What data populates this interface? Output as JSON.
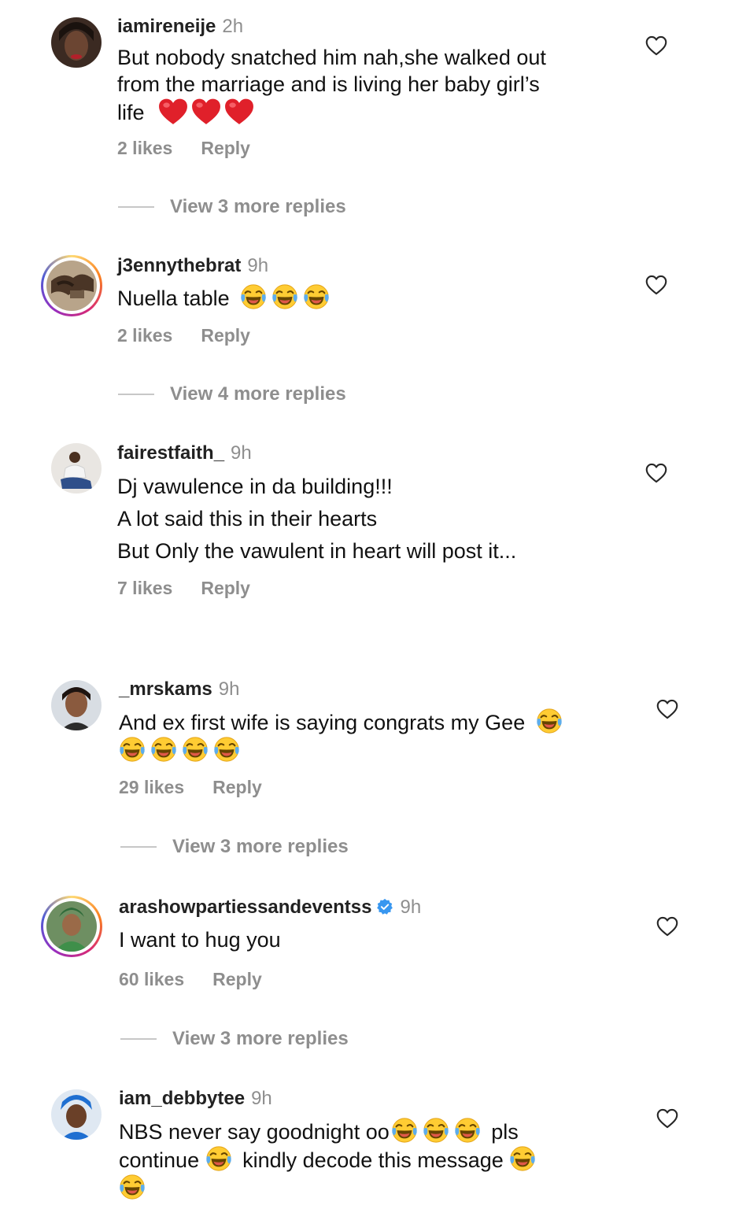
{
  "icons": {
    "like": "heart-outline-icon",
    "verified": "verified-badge-icon",
    "laugh_emoji": "face-with-tears-of-joy-emoji",
    "red_heart_emoji": "red-heart-emoji"
  },
  "colors": {
    "muted": "#8e8e8e",
    "text": "#111111",
    "verified_blue": "#3897f0",
    "story_ring": "#d62976"
  },
  "comments": [
    {
      "username": "iamireneije",
      "time": "2h",
      "text_lines": [
        "But nobody snatched him nah,she walked out",
        "from the marriage and is living her baby girl’s",
        "life"
      ],
      "likes": "2 likes",
      "reply": "Reply",
      "view_more": "View 3 more replies"
    },
    {
      "username": "j3ennythebrat",
      "time": "9h",
      "text_lines": [
        "Nuella table"
      ],
      "likes": "2 likes",
      "reply": "Reply",
      "view_more": "View 4 more replies"
    },
    {
      "username": "fairestfaith_",
      "time": "9h",
      "text_lines": [
        "Dj vawulence in da building!!!",
        "A lot said this in their hearts",
        "But Only the vawulent in heart will post it..."
      ],
      "likes": "7 likes",
      "reply": "Reply"
    },
    {
      "username": "_mrskams",
      "time": "9h",
      "text_lines": [
        "And ex first wife is saying congrats my Gee"
      ],
      "likes": "29 likes",
      "reply": "Reply",
      "view_more": "View 3 more replies"
    },
    {
      "username": "arashowpartiessandeventss",
      "time": "9h",
      "verified": true,
      "text_lines": [
        "I want to hug you"
      ],
      "likes": "60 likes",
      "reply": "Reply",
      "view_more": "View 3 more replies"
    },
    {
      "username": "iam_debbytee",
      "time": "9h",
      "text_lines": [
        "NBS never say goodnight oo",
        "pls",
        "continue",
        "kindly decode this message"
      ]
    }
  ]
}
